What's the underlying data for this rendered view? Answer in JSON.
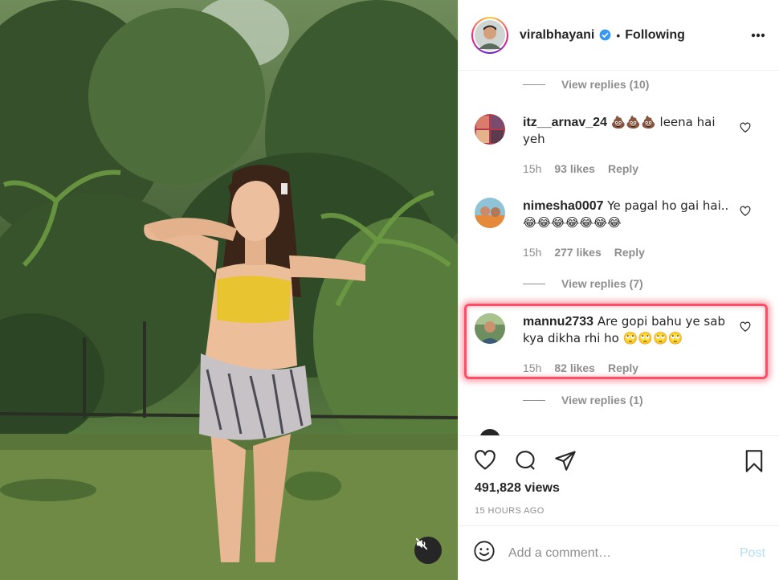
{
  "header": {
    "username": "viralbhayani",
    "separator": "•",
    "follow_status": "Following"
  },
  "comments": [
    {
      "kind": "replies",
      "label": "View replies (10)"
    },
    {
      "kind": "comment",
      "username": "itz__arnav_24",
      "text": " 💩💩💩 leena hai yeh",
      "time": "15h",
      "likes": "93 likes",
      "reply": "Reply"
    },
    {
      "kind": "comment",
      "username": "nimesha0007",
      "text": " Ye pagal ho gai hai..😂😂😂😂😂😂😂",
      "time": "15h",
      "likes": "277 likes",
      "reply": "Reply"
    },
    {
      "kind": "replies",
      "label": "View replies (7)"
    },
    {
      "kind": "comment",
      "username": "mannu2733",
      "text": " Are gopi bahu ye sab kya dikha rhi ho 🙄🙄🙄🙄",
      "time": "15h",
      "likes": "82 likes",
      "reply": "Reply"
    },
    {
      "kind": "replies",
      "label": "View replies (1)"
    }
  ],
  "actions": {
    "views": "491,828 views",
    "posted": "15 HOURS AGO"
  },
  "add_comment": {
    "placeholder": "Add a comment…",
    "post_label": "Post"
  },
  "colors": {
    "highlight": "#ff4d66",
    "verified": "#3897f0",
    "post_disabled": "#b2dffc",
    "muted_text": "#8e8e8e"
  },
  "icons": [
    "volume-off-icon",
    "verified-badge-icon",
    "more-options-icon",
    "heart-icon",
    "comment-icon",
    "share-icon",
    "bookmark-icon",
    "emoji-icon"
  ]
}
